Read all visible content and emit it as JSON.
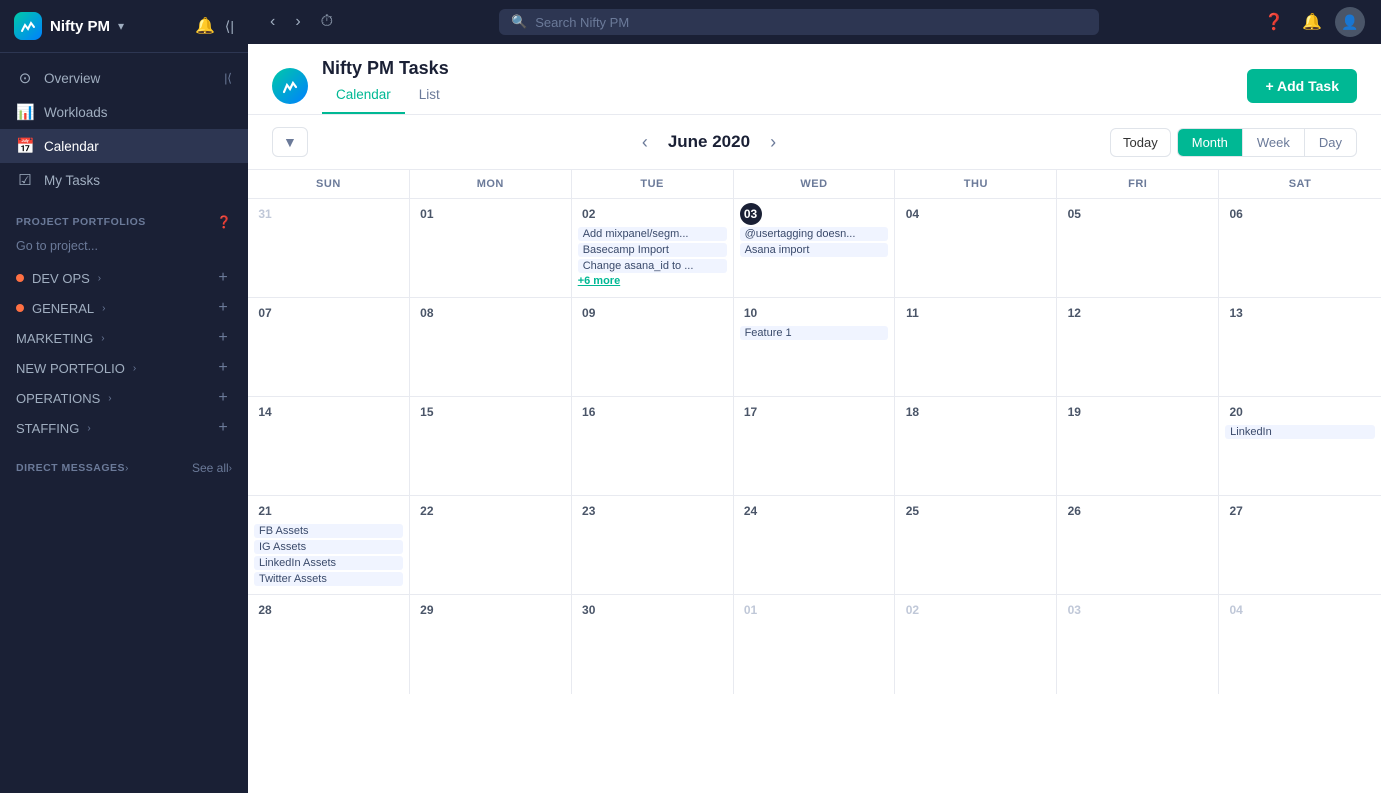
{
  "app": {
    "name": "Nifty PM",
    "logo_text": "Nifty PM",
    "chevron": "▾"
  },
  "topbar": {
    "search_placeholder": "Search Nifty PM",
    "nav_back": "‹",
    "nav_forward": "›",
    "history_icon": "⏱"
  },
  "sidebar": {
    "nav_items": [
      {
        "id": "overview",
        "label": "Overview",
        "icon": "⊙"
      },
      {
        "id": "workloads",
        "label": "Workloads",
        "icon": "📊"
      },
      {
        "id": "calendar",
        "label": "Calendar",
        "icon": "≡",
        "active": true
      },
      {
        "id": "my-tasks",
        "label": "My Tasks",
        "icon": "≡"
      }
    ],
    "portfolios_title": "PROJECT PORTFOLIOS",
    "portfolios_search_placeholder": "Go to project...",
    "projects": [
      {
        "id": "dev-ops",
        "label": "DEV OPS",
        "dot_color": "orange"
      },
      {
        "id": "general",
        "label": "GENERAL",
        "dot_color": "orange"
      },
      {
        "id": "marketing",
        "label": "MARKETING",
        "dot_color": ""
      },
      {
        "id": "new-portfolio",
        "label": "NEW PORTFOLIO",
        "dot_color": ""
      },
      {
        "id": "operations",
        "label": "OPERATIONS",
        "dot_color": ""
      },
      {
        "id": "staffing",
        "label": "STAFFING",
        "dot_color": ""
      }
    ],
    "direct_messages_label": "DIRECT MESSAGES",
    "see_all_label": "See all"
  },
  "page": {
    "title": "Nifty PM Tasks",
    "tabs": [
      {
        "id": "calendar",
        "label": "Calendar",
        "active": true
      },
      {
        "id": "list",
        "label": "List",
        "active": false
      }
    ],
    "add_task_label": "+ Add Task"
  },
  "calendar": {
    "month_label": "June 2020",
    "filter_icon": "▼",
    "today_label": "Today",
    "view_buttons": [
      {
        "id": "month",
        "label": "Month",
        "active": true
      },
      {
        "id": "week",
        "label": "Week",
        "active": false
      },
      {
        "id": "day",
        "label": "Day",
        "active": false
      }
    ],
    "days_of_week": [
      "SUN",
      "MON",
      "TUE",
      "WED",
      "THU",
      "FRI",
      "SAT"
    ],
    "weeks": [
      {
        "days": [
          {
            "num": "31",
            "other_month": true,
            "events": []
          },
          {
            "num": "01",
            "events": []
          },
          {
            "num": "02",
            "events": [
              "Add mixpanel/segm...",
              "Basecamp Import",
              "Change asana_id to ..."
            ],
            "more": "+6 more"
          },
          {
            "num": "03",
            "today": true,
            "events": [
              "@usertagging doesn...",
              "Asana import"
            ]
          },
          {
            "num": "04",
            "events": []
          },
          {
            "num": "05",
            "events": []
          },
          {
            "num": "06",
            "events": []
          }
        ]
      },
      {
        "days": [
          {
            "num": "07",
            "events": []
          },
          {
            "num": "08",
            "events": []
          },
          {
            "num": "09",
            "events": []
          },
          {
            "num": "10",
            "events": [
              "Feature 1"
            ]
          },
          {
            "num": "11",
            "events": []
          },
          {
            "num": "12",
            "events": []
          },
          {
            "num": "13",
            "events": []
          }
        ]
      },
      {
        "days": [
          {
            "num": "14",
            "events": []
          },
          {
            "num": "15",
            "events": []
          },
          {
            "num": "16",
            "events": []
          },
          {
            "num": "17",
            "events": []
          },
          {
            "num": "18",
            "events": []
          },
          {
            "num": "19",
            "events": []
          },
          {
            "num": "20",
            "events": [
              "LinkedIn"
            ]
          }
        ]
      },
      {
        "days": [
          {
            "num": "21",
            "events": [
              "FB Assets",
              "IG Assets",
              "LinkedIn Assets",
              "Twitter Assets"
            ]
          },
          {
            "num": "22",
            "events": []
          },
          {
            "num": "23",
            "events": []
          },
          {
            "num": "24",
            "events": []
          },
          {
            "num": "25",
            "events": []
          },
          {
            "num": "26",
            "events": []
          },
          {
            "num": "27",
            "events": []
          }
        ]
      },
      {
        "days": [
          {
            "num": "28",
            "events": []
          },
          {
            "num": "29",
            "events": []
          },
          {
            "num": "30",
            "events": []
          },
          {
            "num": "01",
            "other_month": true,
            "events": []
          },
          {
            "num": "02",
            "other_month": true,
            "events": []
          },
          {
            "num": "03",
            "other_month": true,
            "events": []
          },
          {
            "num": "04",
            "other_month": true,
            "events": []
          }
        ]
      }
    ]
  }
}
